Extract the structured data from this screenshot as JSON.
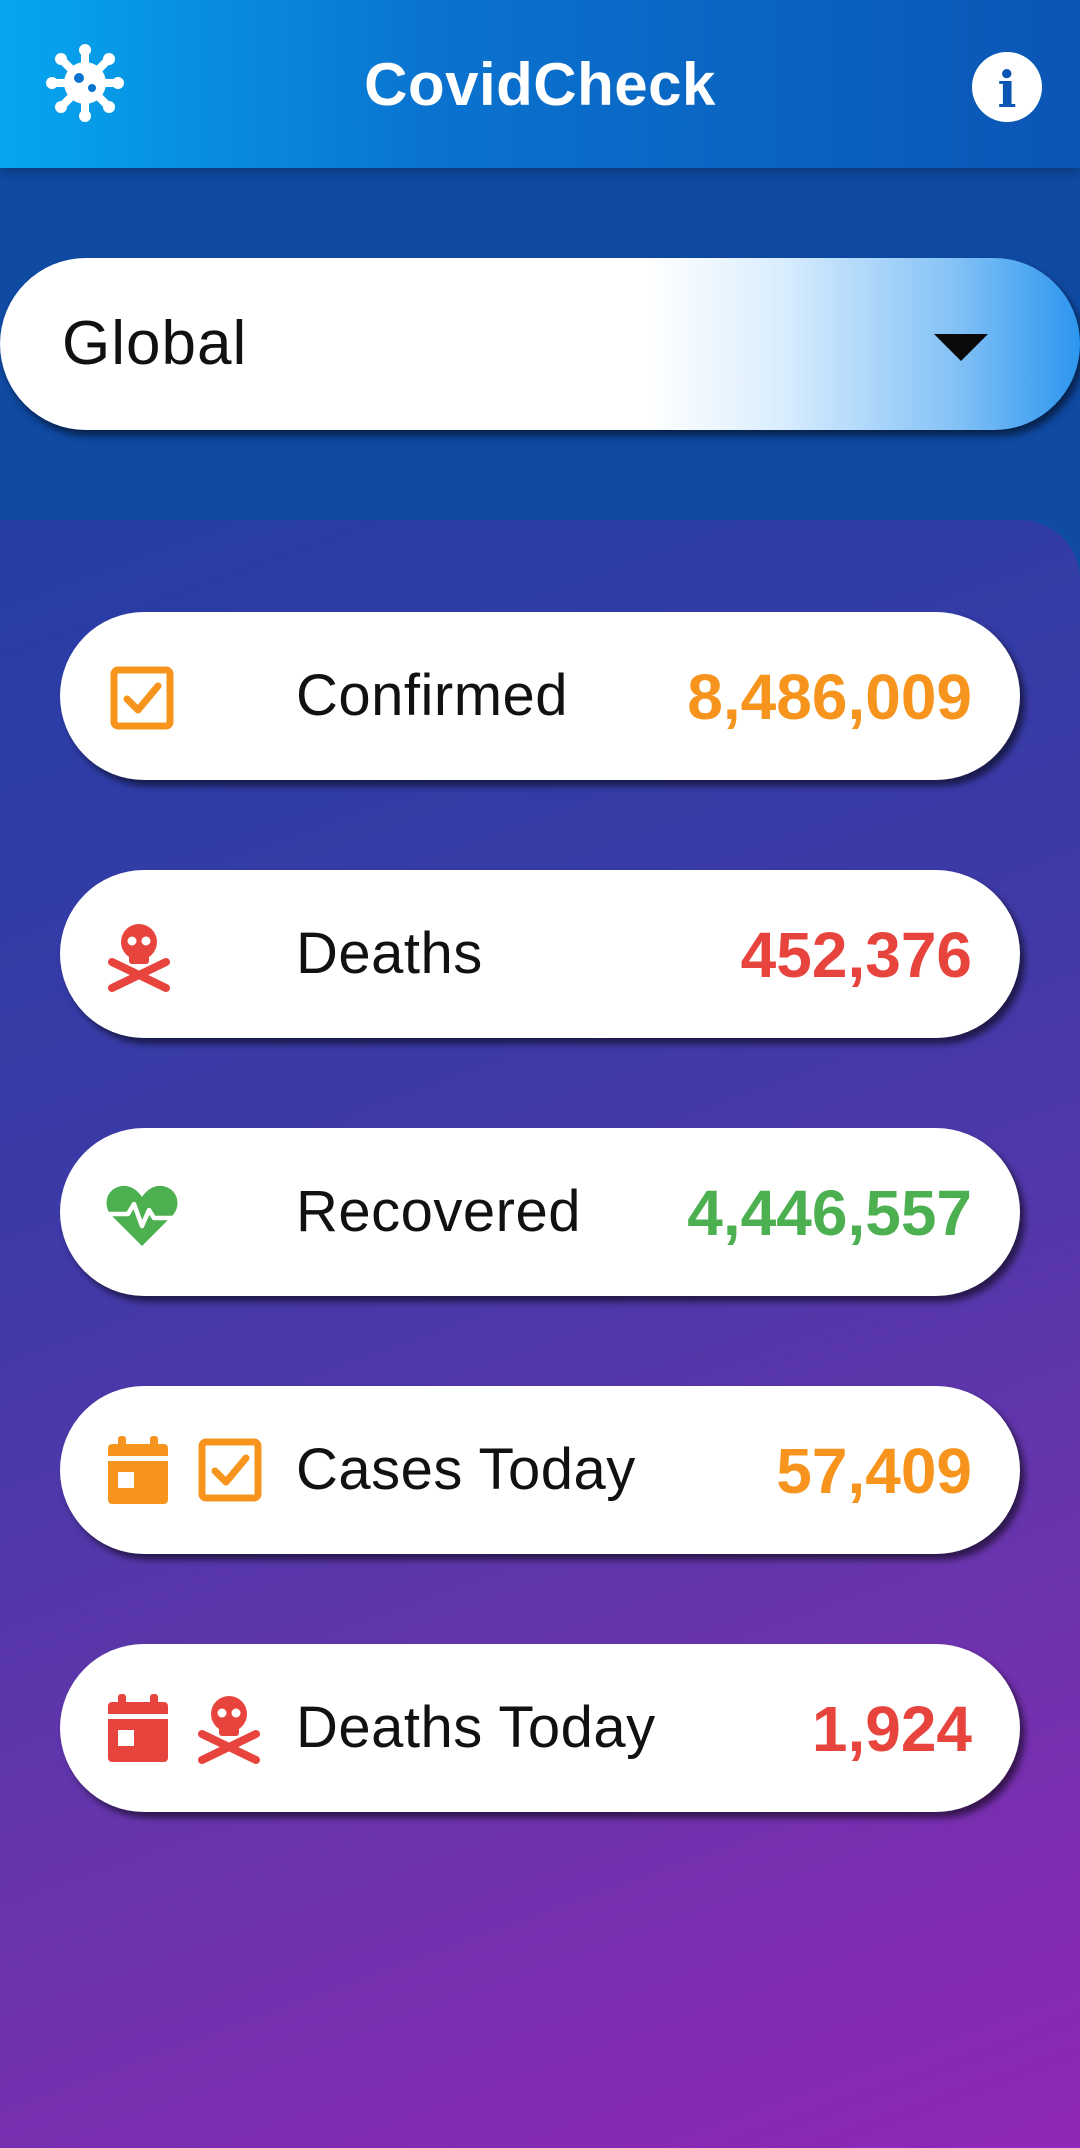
{
  "app": {
    "title": "CovidCheck"
  },
  "header": {
    "settings_icon": "virus-gear-icon",
    "info_icon": "info-icon",
    "info_glyph": "i"
  },
  "region_select": {
    "selected": "Global"
  },
  "colors": {
    "confirmed": "#F7941D",
    "deaths": "#E8443E",
    "recovered": "#4CAF50",
    "header_start": "#06A6EF",
    "header_end": "#0B55B4"
  },
  "stats": [
    {
      "label": "Confirmed",
      "value": "8,486,009",
      "color": "#F7941D",
      "icons": [
        "checkbox-icon"
      ]
    },
    {
      "label": "Deaths",
      "value": "452,376",
      "color": "#E8443E",
      "icons": [
        "skull-crossbones-icon"
      ]
    },
    {
      "label": "Recovered",
      "value": "4,446,557",
      "color": "#4CAF50",
      "icons": [
        "heartbeat-icon"
      ]
    },
    {
      "label": "Cases Today",
      "value": "57,409",
      "color": "#F7941D",
      "icons": [
        "calendar-icon",
        "checkbox-icon"
      ]
    },
    {
      "label": "Deaths Today",
      "value": "1,924",
      "color": "#E8443E",
      "icons": [
        "calendar-icon",
        "skull-crossbones-icon"
      ]
    }
  ]
}
